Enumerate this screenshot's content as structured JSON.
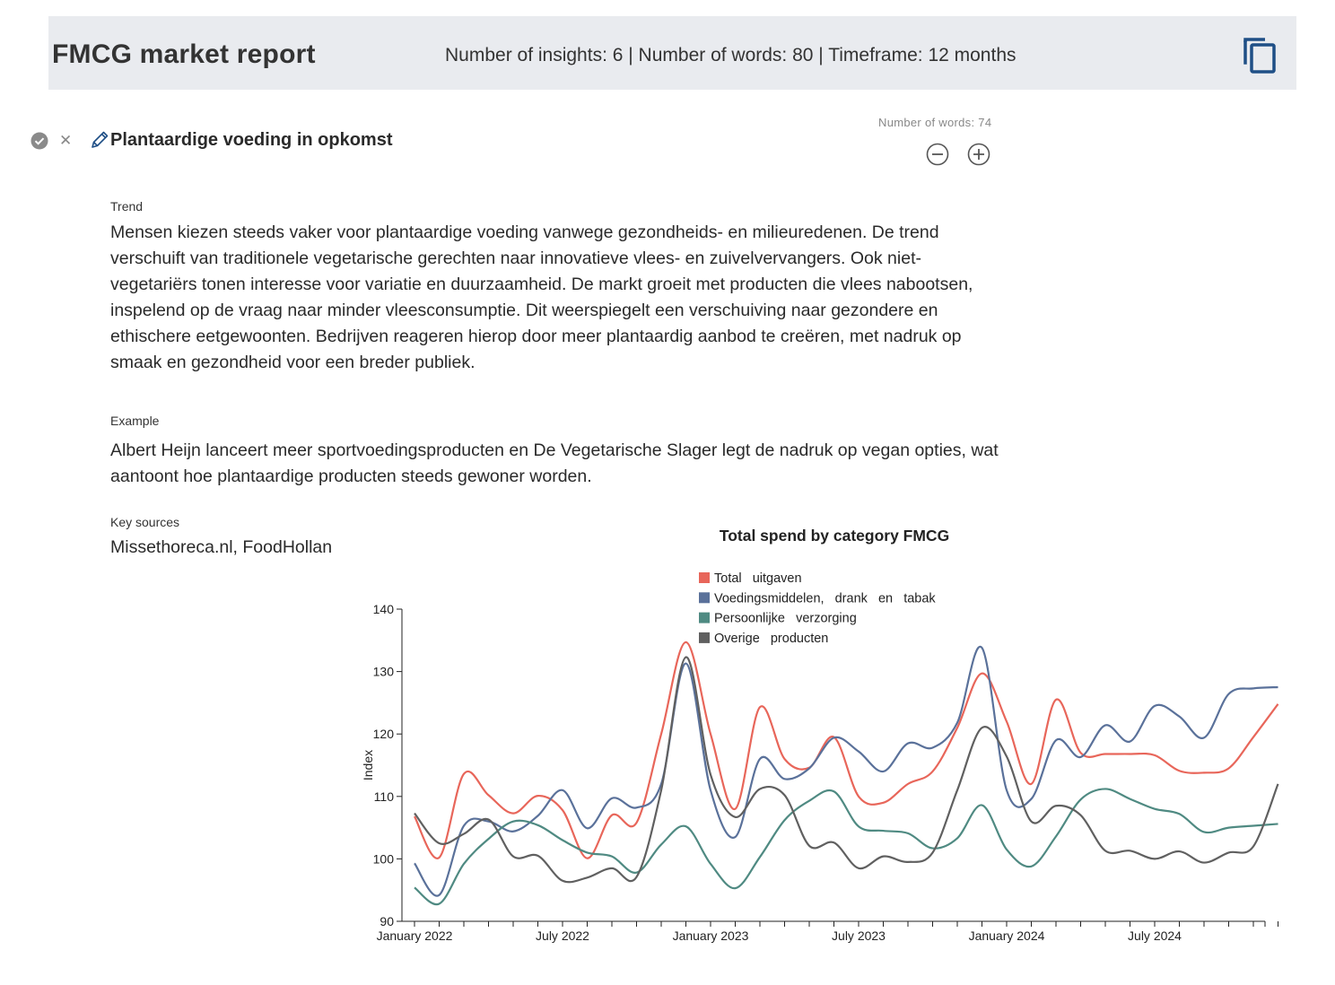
{
  "header": {
    "title": "FMCG market report",
    "meta": "Number of insights: 6 | Number of words: 80 | Timeframe: 12 months",
    "copy_icon": "copy-icon"
  },
  "insight": {
    "title": "Plantaardige voeding in opkomst",
    "word_count_label": "Number of words: 74",
    "icons": [
      "check-circle-icon",
      "close-icon",
      "pencil-icon",
      "minus-circle-icon",
      "plus-circle-icon"
    ],
    "trend_label": "Trend",
    "trend_text": "Mensen kiezen steeds vaker voor plantaardige voeding vanwege gezondheids- en milieuredenen. De trend verschuift van traditionele vegetarische gerechten naar innovatieve vlees- en zuivelvervangers. Ook niet-vegetariërs tonen interesse voor variatie en duurzaamheid. De markt groeit met producten die vlees nabootsen, inspelend op de vraag naar minder vleesconsumptie. Dit weerspiegelt een verschuiving naar gezondere en ethischere eetgewoonten. Bedrijven reageren hierop door meer plantaardig aanbod te creëren, met nadruk op smaak en gezondheid voor een breder publiek.",
    "example_label": "Example",
    "example_text": "Albert Heijn lanceert meer sportvoedingsproducten en De Vegetarische Slager legt de nadruk op vegan opties, wat aantoont hoe plantaardige producten steeds gewoner worden.",
    "sources_label": "Key sources",
    "sources_text": "Missethoreca.nl, FoodHollan"
  },
  "chart_data": {
    "type": "line",
    "title": "Total spend by category FMCG",
    "ylabel": "Index",
    "xlabel": "",
    "ylim": [
      90,
      140
    ],
    "yticks": [
      90,
      100,
      110,
      120,
      130,
      140
    ],
    "xticks": [
      "January 2022",
      "July 2022",
      "January 2023",
      "July 2023",
      "January 2024",
      "July 2024"
    ],
    "legend_position": "top",
    "x": [
      "2022-01",
      "2022-02",
      "2022-03",
      "2022-04",
      "2022-05",
      "2022-06",
      "2022-07",
      "2022-08",
      "2022-09",
      "2022-10",
      "2022-11",
      "2022-12",
      "2023-01",
      "2023-02",
      "2023-03",
      "2023-04",
      "2023-05",
      "2023-06",
      "2023-07",
      "2023-08",
      "2023-09",
      "2023-10",
      "2023-11",
      "2023-12",
      "2024-01",
      "2024-02",
      "2024-03",
      "2024-04",
      "2024-05",
      "2024-06",
      "2024-07",
      "2024-08",
      "2024-09",
      "2024-10",
      "2024-11",
      "2024-12"
    ],
    "series": [
      {
        "name": "Total   uitgaven",
        "color": "#e8665a",
        "values": [
          106.8,
          100.2,
          113.6,
          110.2,
          107.3,
          110.1,
          107.8,
          100.1,
          107.0,
          105.8,
          120.0,
          134.7,
          120.0,
          108.0,
          124.3,
          116.0,
          114.6,
          119.5,
          110.0,
          109.0,
          112.0,
          114.0,
          121.0,
          129.7,
          122.0,
          112.0,
          125.5,
          117.0,
          116.8,
          116.8,
          116.6,
          114.1,
          113.8,
          114.5,
          119.5,
          124.8
        ]
      },
      {
        "name": "Voedingsmiddelen,   drank   en   tabak",
        "color": "#5a719a",
        "values": [
          99.3,
          94.2,
          105.3,
          106.0,
          104.4,
          106.9,
          111.0,
          104.9,
          109.7,
          108.2,
          112.0,
          131.3,
          111.0,
          103.5,
          116.0,
          112.8,
          114.5,
          119.4,
          117.2,
          114.0,
          118.5,
          117.8,
          121.8,
          133.8,
          111.0,
          109.6,
          119.0,
          116.3,
          121.4,
          118.8,
          124.5,
          122.8,
          119.4,
          126.4,
          127.3,
          127.5
        ]
      },
      {
        "name": "Persoonlijke   verzorging",
        "color": "#4f8a82",
        "values": [
          95.4,
          92.8,
          99.2,
          103.2,
          106.0,
          105.4,
          103.0,
          101.0,
          100.4,
          97.8,
          102.3,
          105.2,
          99.2,
          95.3,
          100.3,
          106.2,
          109.3,
          110.8,
          105.2,
          104.5,
          104.1,
          101.7,
          103.3,
          108.6,
          101.5,
          98.8,
          103.6,
          109.5,
          111.2,
          109.6,
          108.0,
          107.2,
          104.3,
          105.0,
          105.3,
          105.6
        ]
      },
      {
        "name": "Overige   producten",
        "color": "#606060",
        "values": [
          107.3,
          102.5,
          104.0,
          106.3,
          100.4,
          100.5,
          96.5,
          97.0,
          98.5,
          97.1,
          111.0,
          132.3,
          113.5,
          106.7,
          111.2,
          110.2,
          102.1,
          102.6,
          98.5,
          100.4,
          99.5,
          101.0,
          111.0,
          121.0,
          116.4,
          106.0,
          108.5,
          107.0,
          101.3,
          101.3,
          100.0,
          101.2,
          99.4,
          101.0,
          102.0,
          112.0
        ]
      }
    ]
  }
}
